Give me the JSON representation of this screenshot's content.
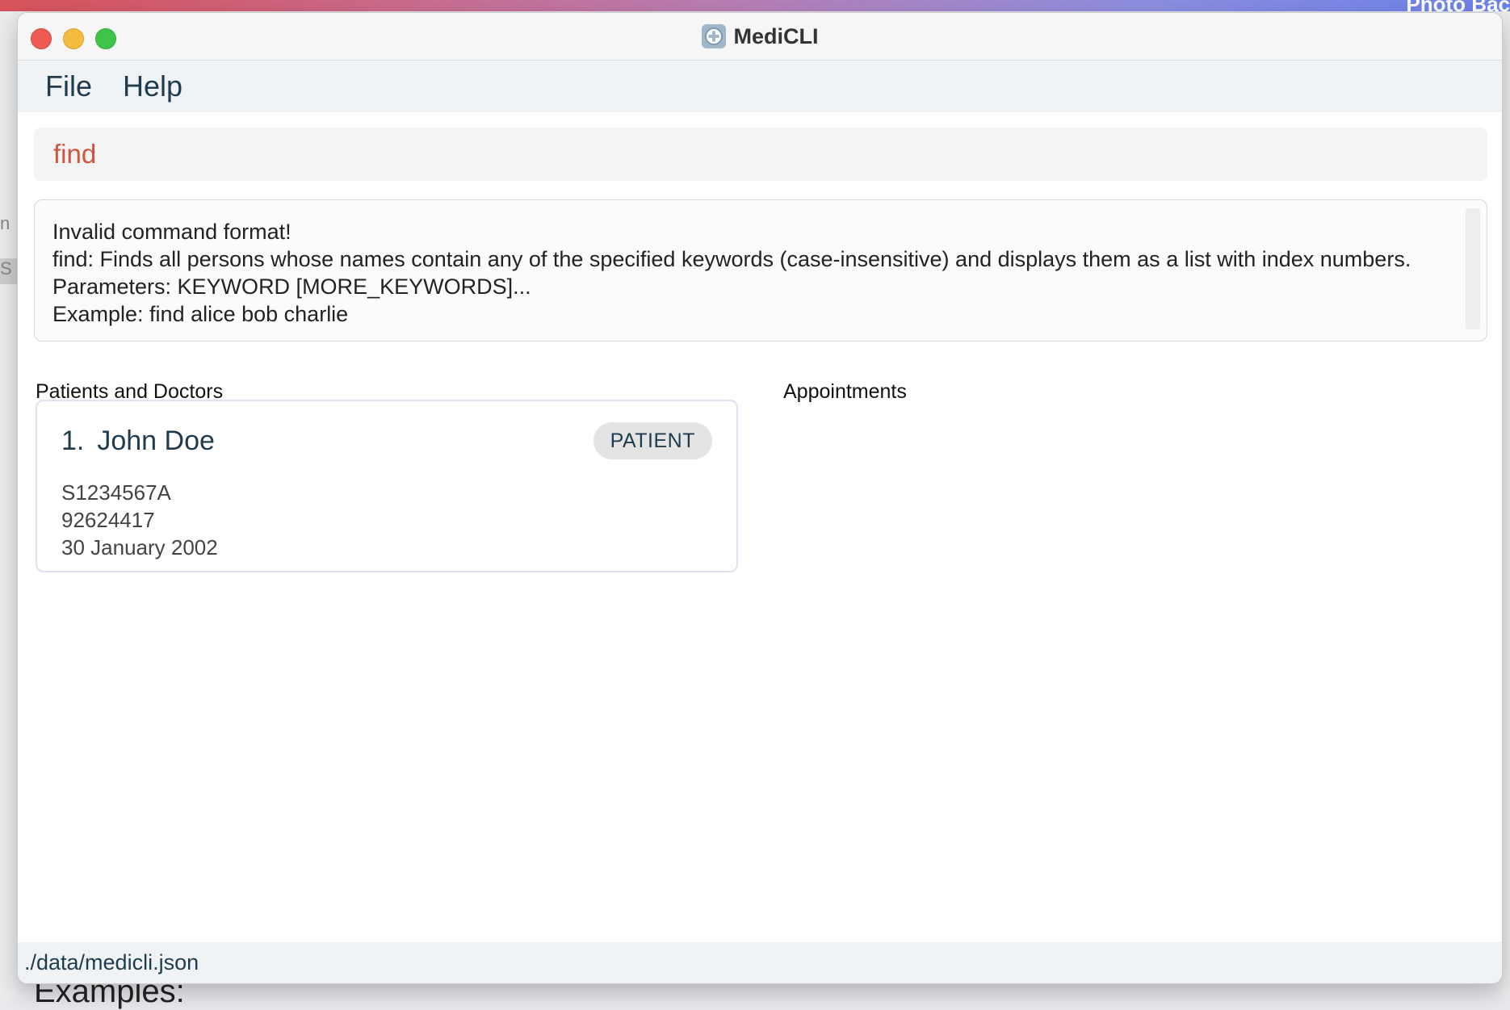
{
  "window": {
    "title": "MediCLI",
    "app_icon": "medical-cross-icon"
  },
  "background": {
    "top_right_text": "Photo Bac",
    "bottom_text": "Examples:",
    "left_letters": [
      "n",
      "S"
    ]
  },
  "menu": {
    "items": [
      {
        "label": "File"
      },
      {
        "label": "Help"
      }
    ]
  },
  "command": {
    "value": "find",
    "text_color": "#d0553d"
  },
  "result": {
    "lines": [
      "Invalid command format!",
      "find: Finds all persons whose names contain any of the specified keywords (case-insensitive) and displays them as a list with index numbers.",
      "Parameters: KEYWORD [MORE_KEYWORDS]...",
      "Example: find alice bob charlie"
    ]
  },
  "panels": {
    "persons_title": "Patients and Doctors",
    "appointments_title": "Appointments"
  },
  "persons": [
    {
      "index": "1.",
      "name": "John Doe",
      "role": "PATIENT",
      "nric": "S1234567A",
      "phone": "92624417",
      "dob": "30 January 2002"
    }
  ],
  "status": {
    "file_path": "./data/medicli.json"
  },
  "colors": {
    "accent": "#1f3b4d",
    "command_text": "#d0553d",
    "badge_bg": "#e4e4e4"
  }
}
